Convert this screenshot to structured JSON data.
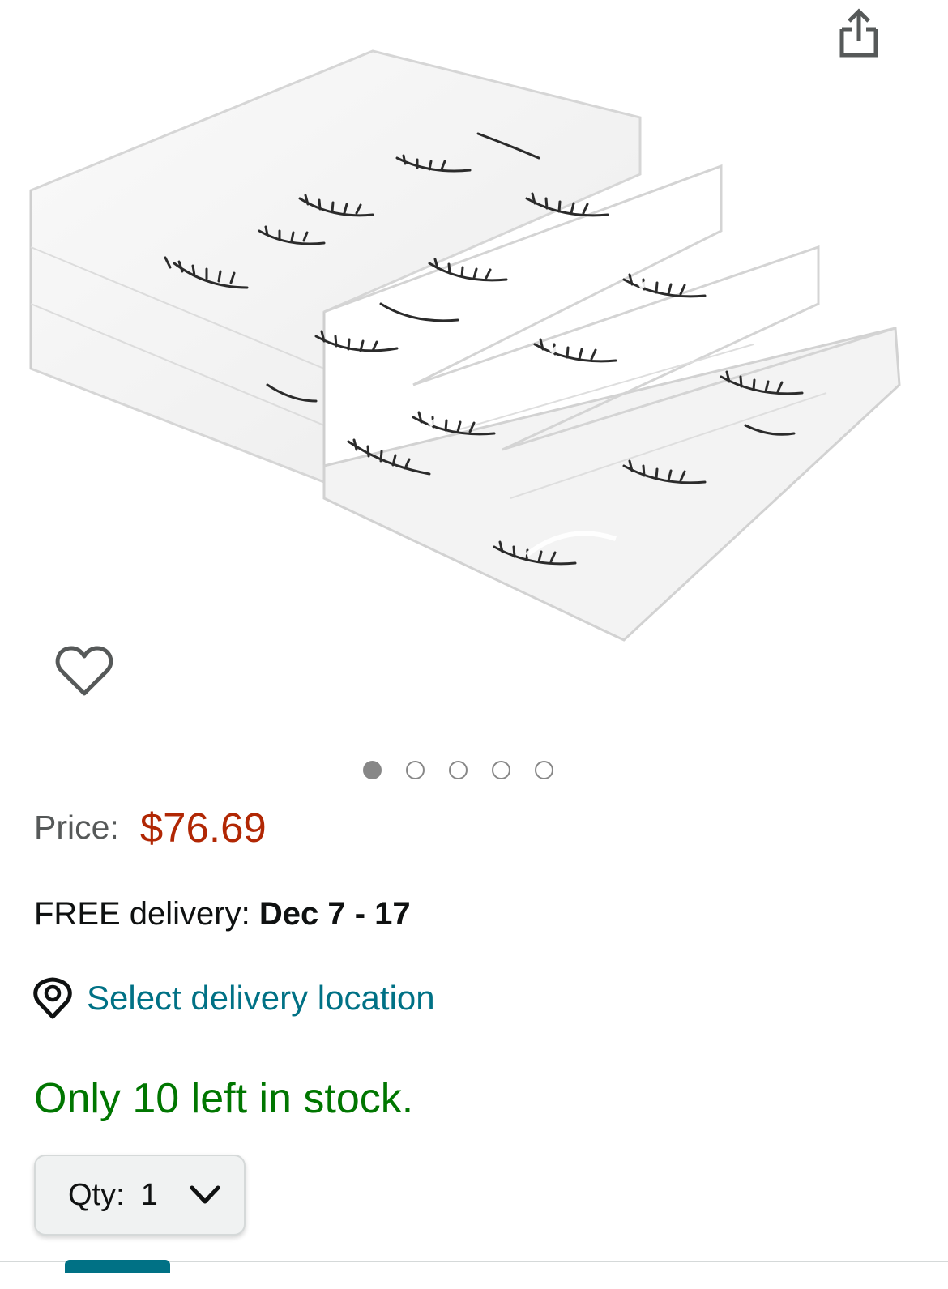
{
  "gallery": {
    "image_count": 5,
    "active_index": 0
  },
  "price": {
    "label": "Price:",
    "value": "$76.69"
  },
  "delivery": {
    "prefix": "FREE delivery: ",
    "dates": "Dec 7 - 17"
  },
  "location": {
    "link_text": "Select delivery location"
  },
  "stock": {
    "message": "Only 10 left in stock."
  },
  "quantity": {
    "label": "Qty:",
    "value": "1"
  },
  "icons": {
    "share": "share-icon",
    "wishlist": "heart-icon",
    "location": "location-pin-icon",
    "dropdown": "chevron-down-icon"
  },
  "colors": {
    "price": "#b12704",
    "link": "#007185",
    "in_stock": "#007600",
    "dot": "#878787"
  }
}
